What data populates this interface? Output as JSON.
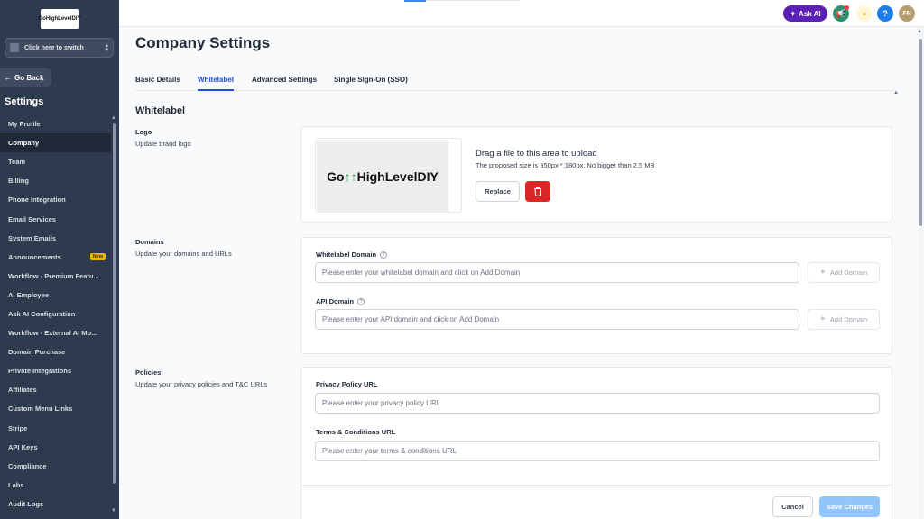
{
  "sidebar": {
    "logo_text": "GoHighLevelDIY",
    "switcher_label": "Click here to switch",
    "go_back": "Go Back",
    "settings_title": "Settings",
    "items": [
      {
        "label": "My Profile"
      },
      {
        "label": "Company",
        "active": true
      },
      {
        "label": "Team"
      },
      {
        "label": "Billing"
      },
      {
        "label": "Phone Integration"
      },
      {
        "label": "Email Services"
      },
      {
        "label": "System Emails"
      },
      {
        "label": "Announcements",
        "badge": "New"
      },
      {
        "label": "Workflow - Premium Featu..."
      },
      {
        "label": "AI Employee"
      },
      {
        "label": "Ask AI Configuration"
      },
      {
        "label": "Workflow - External AI Mo..."
      },
      {
        "label": "Domain Purchase"
      },
      {
        "label": "Private Integrations"
      },
      {
        "label": "Affiliates"
      },
      {
        "label": "Custom Menu Links"
      },
      {
        "label": "Stripe"
      },
      {
        "label": "API Keys"
      },
      {
        "label": "Compliance"
      },
      {
        "label": "Labs"
      },
      {
        "label": "Audit Logs"
      }
    ]
  },
  "topbar": {
    "ask_ai": "Ask AI",
    "avatar_initials": "FN",
    "help": "?"
  },
  "page": {
    "title": "Company Settings",
    "tabs": [
      "Basic Details",
      "Whitelabel",
      "Advanced Settings",
      "Single Sign-On (SSO)"
    ],
    "active_tab": "Whitelabel",
    "section_title": "Whitelabel"
  },
  "logo_section": {
    "title": "Logo",
    "subtitle": "Update brand logo",
    "preview_text_a": "Go",
    "preview_text_b": "HighLevelDIY",
    "upload_title": "Drag a file to this area to upload",
    "upload_sub": "The proposed size is 350px * 180px. No bigger than 2.5 MB",
    "replace_label": "Replace"
  },
  "domains_section": {
    "title": "Domains",
    "subtitle": "Update your domains and URLs",
    "whitelabel_label": "Whitelabel Domain",
    "whitelabel_placeholder": "Please enter your whitelabel domain and click on Add Domain",
    "api_label": "API Domain",
    "api_placeholder": "Please enter your API domain and click on Add Domain",
    "add_domain_label": "Add Domain"
  },
  "policies_section": {
    "title": "Policies",
    "subtitle": "Update your privacy policies and T&C URLs",
    "privacy_label": "Privacy Policy URL",
    "privacy_placeholder": "Please enter your privacy policy URL",
    "terms_label": "Terms & Conditions URL",
    "terms_placeholder": "Please enter your terms & conditions URL"
  },
  "footer": {
    "cancel": "Cancel",
    "save": "Save Changes"
  },
  "colors": {
    "sidebar_bg": "#2e3a4e",
    "accent": "#1d4ed8",
    "ask_ai": "#5b21b6",
    "danger": "#dc2626",
    "save_disabled": "#93c5fd"
  }
}
